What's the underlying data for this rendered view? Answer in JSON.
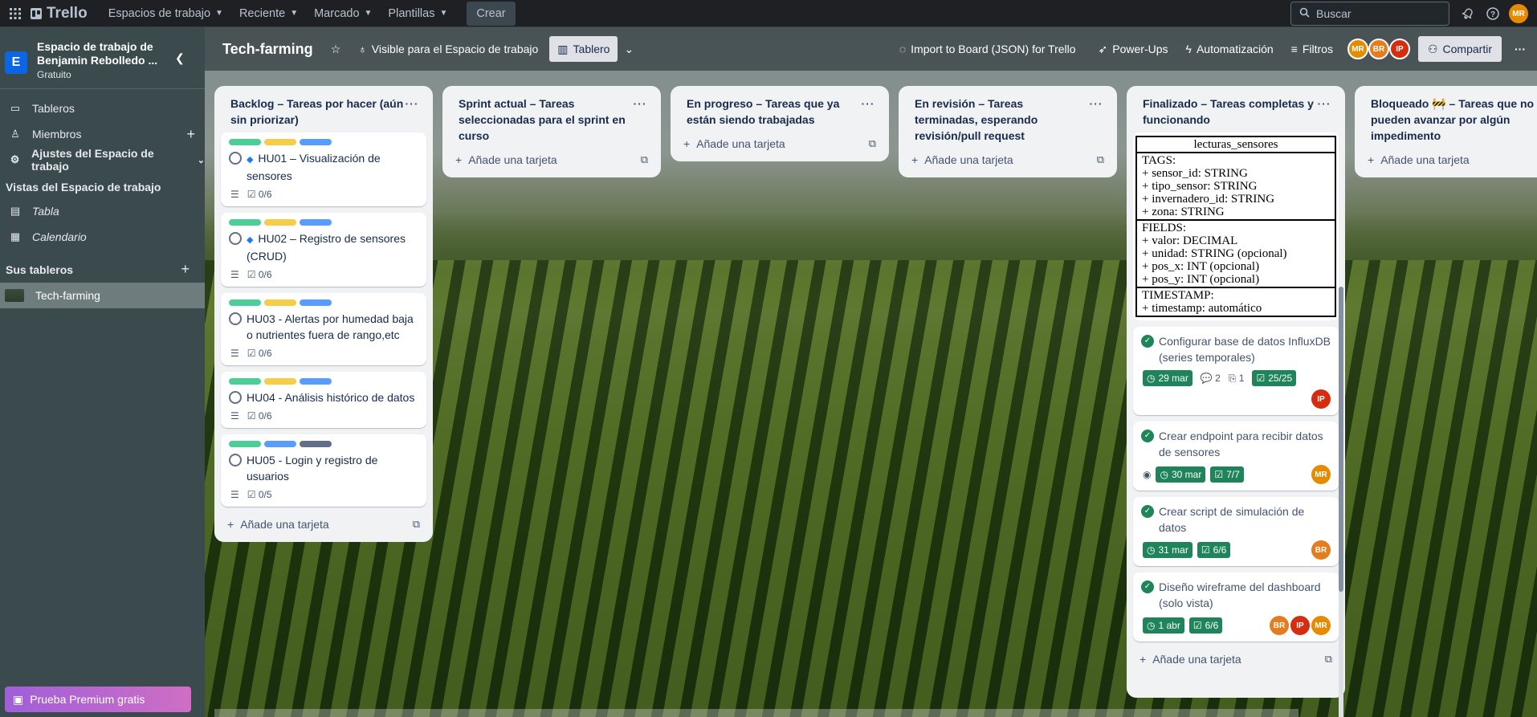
{
  "topbar": {
    "app": "Trello",
    "nav": [
      "Espacios de trabajo",
      "Reciente",
      "Marcado",
      "Plantillas"
    ],
    "create": "Crear",
    "search_placeholder": "Buscar",
    "user_avatar": "MR"
  },
  "sidebar": {
    "workspace_name": "Espacio de trabajo de Benjamin Rebolledo ...",
    "workspace_initial": "E",
    "plan": "Gratuito",
    "items": [
      "Tableros",
      "Miembros",
      "Ajustes del Espacio de trabajo"
    ],
    "views_heading": "Vistas del Espacio de trabajo",
    "views": [
      "Tabla",
      "Calendario"
    ],
    "boards_heading": "Sus tableros",
    "boards": [
      "Tech-farming"
    ],
    "premium": "Prueba Premium gratis"
  },
  "boardbar": {
    "title": "Tech-farming",
    "visibility": "Visible para el Espacio de trabajo",
    "view": "Tablero",
    "import": "Import to Board (JSON) for Trello",
    "powerups": "Power-Ups",
    "automation": "Automatización",
    "filters": "Filtros",
    "members": [
      "MR",
      "BR",
      "IP"
    ],
    "share": "Compartir"
  },
  "add_card": "Añade una tarjeta",
  "lists": [
    {
      "title": "Backlog – Tareas por hacer (aún sin priorizar)"
    },
    {
      "title": "Sprint actual – Tareas seleccionadas para el sprint en curso"
    },
    {
      "title": "En progreso – Tareas que ya están siendo trabajadas"
    },
    {
      "title": "En revisión – Tareas terminadas, esperando revisión/pull request"
    },
    {
      "title": "Finalizado – Tareas completas y funcionando"
    },
    {
      "title": "Bloqueado 🚧 – Tareas que no pueden avanzar por algún impedimento"
    }
  ],
  "backlog_cards": [
    {
      "title": "HU01 – Visualización de sensores",
      "checklist": "0/6"
    },
    {
      "title": "HU02 – Registro de sensores (CRUD)",
      "checklist": "0/6"
    },
    {
      "title": "HU03 - Alertas por humedad baja o nutrientes fuera de rango,etc",
      "checklist": "0/6"
    },
    {
      "title": "HU04 - Análisis histórico de datos",
      "checklist": "0/6"
    },
    {
      "title": "HU05 - Login y registro de usuarios",
      "checklist": "0/5"
    }
  ],
  "schema": {
    "name": "lecturas_sensores",
    "tags_heading": "TAGS:",
    "tags": [
      "+ sensor_id: STRING",
      "+ tipo_sensor: STRING",
      "+ invernadero_id: STRING",
      "+ zona: STRING"
    ],
    "fields_heading": "FIELDS:",
    "fields": [
      "+ valor: DECIMAL",
      "+ unidad: STRING (opcional)",
      "+ pos_x: INT (opcional)",
      "+ pos_y: INT (opcional)"
    ],
    "timestamp_heading": "TIMESTAMP:",
    "timestamp": [
      "+ timestamp: automático"
    ]
  },
  "done_cards": [
    {
      "title": "Configurar base de datos InfluxDB (series temporales)",
      "date": "29 mar",
      "comments": "2",
      "attachments": "1",
      "checklist": "25/25",
      "members": [
        "IP"
      ]
    },
    {
      "title": "Crear endpoint para recibir datos de sensores",
      "date": "30 mar",
      "checklist": "7/7",
      "members": [
        "MR"
      ]
    },
    {
      "title": "Crear script de simulación de datos",
      "date": "31 mar",
      "checklist": "6/6",
      "members": [
        "BR"
      ]
    },
    {
      "title": "Diseño wireframe del dashboard (solo vista)",
      "date": "1 abr",
      "checklist": "6/6",
      "members": [
        "BR",
        "IP",
        "MR"
      ]
    }
  ]
}
